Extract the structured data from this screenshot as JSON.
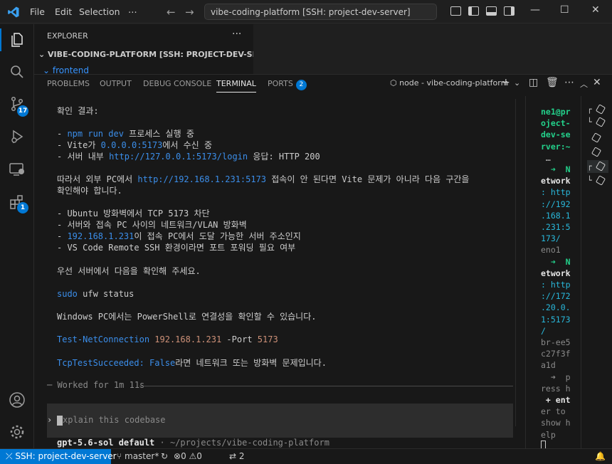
{
  "titlebar": {
    "menu": [
      "File",
      "Edit",
      "Selection",
      "⋯"
    ],
    "command_center": "vibe-coding-platform [SSH: project-dev-server]"
  },
  "activity": {
    "source_control_badge": "17",
    "extensions_badge": "1"
  },
  "explorer": {
    "title": "EXPLORER",
    "more": "···",
    "root": "VIBE-CODING-PLATFORM [SSH: PROJECT-DEV-SERVER]",
    "folder": "frontend"
  },
  "panel": {
    "tabs": [
      "PROBLEMS",
      "OUTPUT",
      "DEBUG CONSOLE",
      "TERMINAL",
      "PORTS"
    ],
    "ports_badge": "2",
    "terminal_name": "node - vibe-coding-platform"
  },
  "terminal": {
    "result_heading": "확인 결과:",
    "b1_prefix": "- ",
    "b1_cmd": "npm run dev",
    "b1_text": " 프로세스 실행 중",
    "b2_prefix": "- Vite가 ",
    "b2_addr": "0.0.0.0:5173",
    "b2_text": "에서 수신 중",
    "b3_prefix": "- 서버 내부 ",
    "b3_url": "http://127.0.0.1:5173/login",
    "b3_text": " 응답: HTTP 200",
    "p1_prefix": "따라서 외부 PC에서 ",
    "p1_url": "http://192.168.1.231:5173",
    "p1_text": " 접속이 안 된다면 Vite 문제가 아니라 다음 구간을",
    "p1_line2": "확인해야 합니다.",
    "c1": "- Ubuntu 방화벽에서 TCP 5173 차단",
    "c2": "- 서버와 접속 PC 사이의 네트워크/VLAN 방화벽",
    "c3_prefix": "- ",
    "c3_ip": "192.168.1.231",
    "c3_text": "이 접속 PC에서 도달 가능한 서버 주소인지",
    "c4": "- VS Code Remote SSH 환경이라면 포트 포워딩 필요 여부",
    "p2": "우선 서버에서 다음을 확인해 주세요.",
    "sudo": "sudo",
    "ufw": " ufw status",
    "p3": "Windows PC에서는 PowerShell로 연결성을 확인할 수 있습니다.",
    "tnc": "Test-NetConnection",
    "tnc_ip": "192.168.1.231",
    "tnc_port_flag": " -Port ",
    "tnc_port": "5173",
    "tts": "TcpTestSucceeded:",
    "tts_false": " False",
    "tts_text": "라면 네트워크 또는 방화벽 문제입니다.",
    "worked": "─ Worked for 1m 11s",
    "explain_caret": "›",
    "explain_placeholder": "xplain this codebase",
    "model": "gpt-5.6-sol default",
    "model_path": " · ~/projects/vibe-coding-platform"
  },
  "side_terminal": {
    "lines": [
      {
        "t": "ne1@pr",
        "c": "green"
      },
      {
        "t": "oject-",
        "c": "green"
      },
      {
        "t": "dev-se",
        "c": "green"
      },
      {
        "t": "rver:~",
        "c": "green"
      },
      {
        "t": " …",
        "c": "plain"
      },
      {
        "t": "  ➜  N",
        "c": "greenbold"
      },
      {
        "t": "etwork",
        "c": "boldw"
      },
      {
        "t": ": http",
        "c": "cyan"
      },
      {
        "t": "://192",
        "c": "cyan"
      },
      {
        "t": ".168.1",
        "c": "cyan"
      },
      {
        "t": ".231:5",
        "c": "cyan"
      },
      {
        "t": "173/",
        "c": "cyan"
      },
      {
        "t": "eno1",
        "c": "gray"
      },
      {
        "t": "  ➜  N",
        "c": "greenbold"
      },
      {
        "t": "etwork",
        "c": "boldw"
      },
      {
        "t": ": http",
        "c": "cyan"
      },
      {
        "t": "://172",
        "c": "cyan"
      },
      {
        "t": ".20.0.",
        "c": "cyan"
      },
      {
        "t": "1:5173",
        "c": "cyan"
      },
      {
        "t": "/",
        "c": "cyan"
      },
      {
        "t": "br-ee5",
        "c": "gray"
      },
      {
        "t": "c27f3f",
        "c": "gray"
      },
      {
        "t": "a1d",
        "c": "gray"
      },
      {
        "t": "  ➜  p",
        "c": "gray"
      },
      {
        "t": "ress h",
        "c": "gray"
      },
      {
        "t": " + ent",
        "c": "boldw"
      },
      {
        "t": "er to",
        "c": "gray"
      },
      {
        "t": "show h",
        "c": "gray"
      },
      {
        "t": "elp",
        "c": "gray"
      }
    ]
  },
  "statusbar": {
    "remote": "SSH: project-dev-server",
    "branch": "master*",
    "errors": "0",
    "warnings": "0",
    "ports": "2"
  }
}
